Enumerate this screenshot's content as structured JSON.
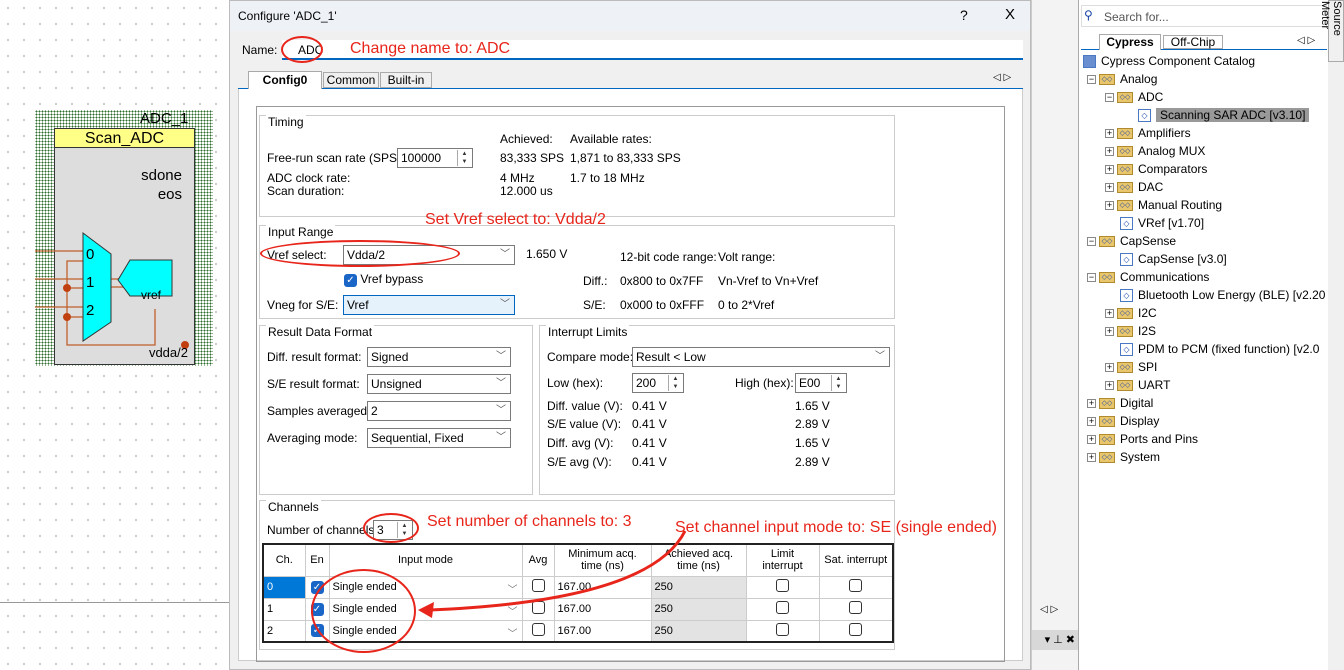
{
  "schematic": {
    "instance_name": "ADC_1",
    "component_title": "Scan_ADC",
    "outputs": [
      "sdone",
      "eos"
    ],
    "mux_inputs": [
      "0",
      "1",
      "2"
    ],
    "vref_label": "vref",
    "vdda_label": "vdda/2"
  },
  "dialog": {
    "title": "Configure 'ADC_1'",
    "help": "?",
    "close": "X",
    "name_label": "Name:",
    "name_value": "ADC",
    "tabs": [
      "Config0",
      "Common",
      "Built-in"
    ],
    "active_tab": "Config0",
    "timing": {
      "label": "Timing",
      "achieved_header": "Achieved:",
      "available_header": "Available rates:",
      "scan_rate_label": "Free-run scan rate (SPS):",
      "scan_rate_value": "100000",
      "scan_rate_achieved": "83,333 SPS",
      "scan_rate_available": "1,871 to 83,333 SPS",
      "clock_label": "ADC clock rate:",
      "clock_achieved": "4 MHz",
      "clock_available": "1.7 to 18 MHz",
      "duration_label": "Scan duration:",
      "duration_value": "12.000 us"
    },
    "input_range": {
      "label": "Input Range",
      "vref_select_label": "Vref select:",
      "vref_select_value": "Vdda/2",
      "vref_voltage": "1.650 V",
      "vref_bypass_label": "Vref bypass",
      "vref_bypass_checked": true,
      "vneg_label": "Vneg for S/E:",
      "vneg_value": "Vref",
      "code_range_header": "12-bit code range:",
      "volt_range_header": "Volt range:",
      "diff_label": "Diff.:",
      "diff_code": "0x800 to 0x7FF",
      "diff_volt": "Vn-Vref to Vn+Vref",
      "se_label": "S/E:",
      "se_code": "0x000 to 0xFFF",
      "se_volt": "0 to 2*Vref"
    },
    "result_format": {
      "label": "Result Data Format",
      "diff_label": "Diff. result format:",
      "diff_value": "Signed",
      "se_label": "S/E result format:",
      "se_value": "Unsigned",
      "samples_label": "Samples averaged:",
      "samples_value": "2",
      "avg_mode_label": "Averaging mode:",
      "avg_mode_value": "Sequential, Fixed"
    },
    "interrupt_limits": {
      "label": "Interrupt Limits",
      "compare_label": "Compare mode:",
      "compare_value": "Result < Low",
      "low_label": "Low (hex):",
      "low_value": "200",
      "high_label": "High (hex):",
      "high_value": "E00",
      "rows": [
        {
          "label": "Diff. value (V):",
          "low": "0.41 V",
          "high": "1.65 V"
        },
        {
          "label": "S/E value (V):",
          "low": "0.41 V",
          "high": "2.89 V"
        },
        {
          "label": "Diff. avg (V):",
          "low": "0.41 V",
          "high": "1.65 V"
        },
        {
          "label": "S/E avg (V):",
          "low": "0.41 V",
          "high": "2.89 V"
        }
      ]
    },
    "channels": {
      "label": "Channels",
      "count_label": "Number of channels:",
      "count_value": "3",
      "headers": [
        "Ch.",
        "En",
        "Input mode",
        "Avg",
        "Minimum acq. time (ns)",
        "Achieved acq. time (ns)",
        "Limit interrupt",
        "Sat. interrupt"
      ],
      "rows": [
        {
          "ch": "0",
          "en": true,
          "mode": "Single ended",
          "avg": false,
          "min_acq": "167.00",
          "achieved": "250",
          "limit": false,
          "sat": false
        },
        {
          "ch": "1",
          "en": true,
          "mode": "Single ended",
          "avg": false,
          "min_acq": "167.00",
          "achieved": "250",
          "limit": false,
          "sat": false
        },
        {
          "ch": "2",
          "en": true,
          "mode": "Single ended",
          "avg": false,
          "min_acq": "167.00",
          "achieved": "250",
          "limit": false,
          "sat": false
        }
      ]
    }
  },
  "annotations": {
    "name": "Change name to: ADC",
    "vref": "Set Vref select to: Vdda/2",
    "channels": "Set number of channels to: 3",
    "input_mode": "Set channel input mode to: SE (single ended)",
    "color": "#e8251b"
  },
  "catalog": {
    "search_placeholder": "Search for...",
    "tabs": [
      "Cypress",
      "Off-Chip"
    ],
    "side_tab": "Source Meter",
    "root": "Cypress Component Catalog",
    "items": [
      {
        "label": "Analog",
        "level": 0,
        "type": "folder",
        "expand": "-"
      },
      {
        "label": "ADC",
        "level": 1,
        "type": "folder",
        "expand": "-"
      },
      {
        "label": "Scanning SAR ADC [v3.10]",
        "level": 2,
        "type": "component",
        "selected": true
      },
      {
        "label": "Amplifiers",
        "level": 1,
        "type": "folder",
        "expand": "+"
      },
      {
        "label": "Analog MUX",
        "level": 1,
        "type": "folder",
        "expand": "+"
      },
      {
        "label": "Comparators",
        "level": 1,
        "type": "folder",
        "expand": "+"
      },
      {
        "label": "DAC",
        "level": 1,
        "type": "folder",
        "expand": "+"
      },
      {
        "label": "Manual Routing",
        "level": 1,
        "type": "folder",
        "expand": "+"
      },
      {
        "label": "VRef [v1.70]",
        "level": 1,
        "type": "component"
      },
      {
        "label": "CapSense",
        "level": 0,
        "type": "folder",
        "expand": "-"
      },
      {
        "label": "CapSense [v3.0]",
        "level": 1,
        "type": "component"
      },
      {
        "label": "Communications",
        "level": 0,
        "type": "folder",
        "expand": "-"
      },
      {
        "label": "Bluetooth Low Energy (BLE) [v2.20",
        "level": 1,
        "type": "component"
      },
      {
        "label": "I2C",
        "level": 1,
        "type": "folder",
        "expand": "+"
      },
      {
        "label": "I2S",
        "level": 1,
        "type": "folder",
        "expand": "+"
      },
      {
        "label": "PDM to PCM (fixed function) [v2.0",
        "level": 1,
        "type": "component"
      },
      {
        "label": "SPI",
        "level": 1,
        "type": "folder",
        "expand": "+"
      },
      {
        "label": "UART",
        "level": 1,
        "type": "folder",
        "expand": "+"
      },
      {
        "label": "Digital",
        "level": 0,
        "type": "folder",
        "expand": "+"
      },
      {
        "label": "Display",
        "level": 0,
        "type": "folder",
        "expand": "+"
      },
      {
        "label": "Ports and Pins",
        "level": 0,
        "type": "folder",
        "expand": "+"
      },
      {
        "label": "System",
        "level": 0,
        "type": "folder",
        "expand": "+"
      }
    ]
  }
}
